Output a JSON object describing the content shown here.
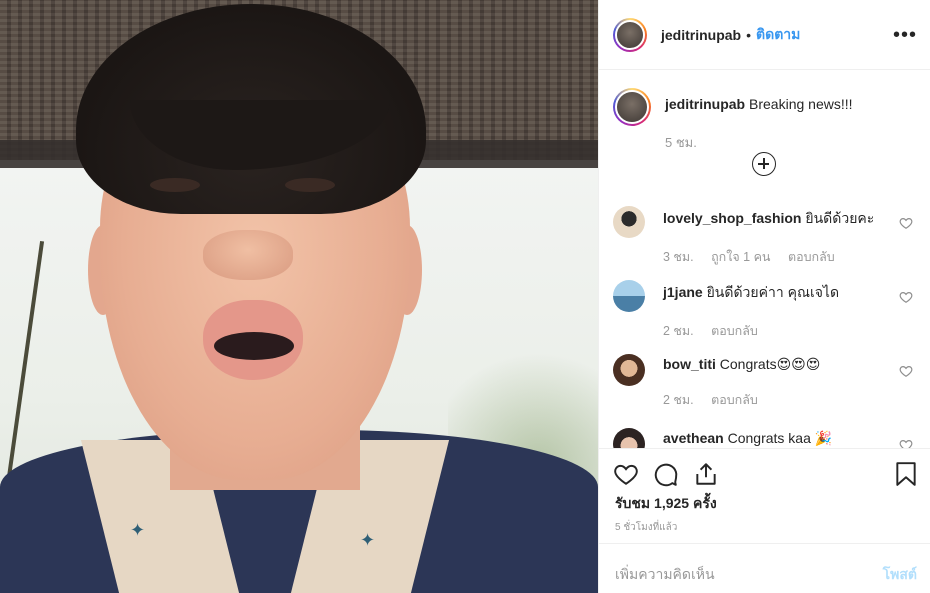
{
  "post": {
    "username": "jeditrinupab",
    "follow_label": "ติดตาม",
    "separator": "•",
    "more_icon": "more-horizontal-icon",
    "caption": {
      "username": "jeditrinupab",
      "text": "Breaking news!!!",
      "time": "5 ชม."
    },
    "load_more_icon": "plus-circle-icon",
    "comments": [
      {
        "username": "lovely_shop_fashion",
        "text": "ยินดีด้วยคะ",
        "time": "3 ชม.",
        "likes": "ถูกใจ 1 คน",
        "reply": "ตอบกลับ",
        "avatar_color": "#d9c9b5"
      },
      {
        "username": "j1jane",
        "text": "ยินดีด้วยค่าา คุณเจได",
        "time": "2 ชม.",
        "likes": "",
        "reply": "ตอบกลับ",
        "avatar_color": "#7fb3d5"
      },
      {
        "username": "bow_titi",
        "text": "Congrats😍😍😍",
        "time": "2 ชม.",
        "likes": "",
        "reply": "ตอบกลับ",
        "avatar_color": "#6b4a3a"
      },
      {
        "username": "avethean",
        "text": "Congrats kaa 🎉",
        "time": "",
        "likes": "",
        "reply": "",
        "avatar_color": "#c9a28c"
      }
    ],
    "views": "รับชม 1,925 ครั้ง",
    "posted_ago": "5 ชั่วโมงที่แล้ว",
    "comment_placeholder": "เพิ่มความคิดเห็น",
    "post_button": "โพสต์"
  },
  "colors": {
    "accent": "#3897f0",
    "post_disabled": "#b2dffc",
    "muted": "#999999"
  }
}
